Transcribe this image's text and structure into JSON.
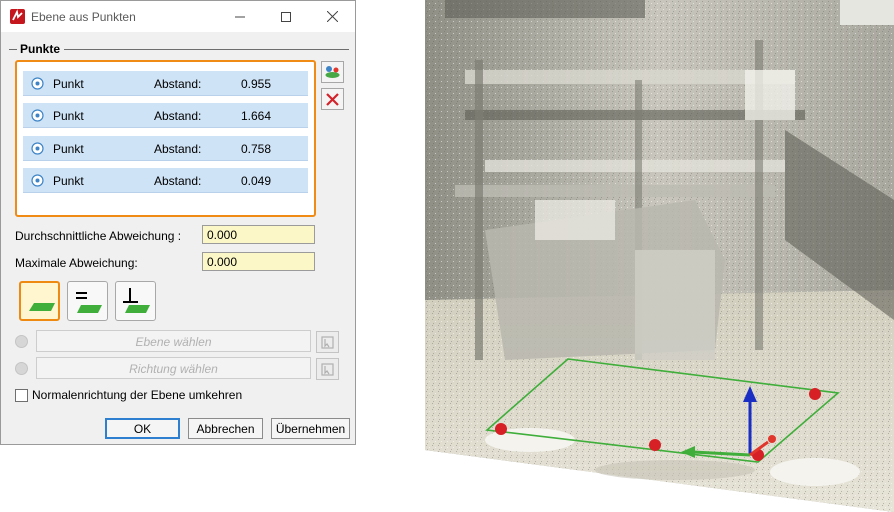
{
  "dialog": {
    "title": "Ebene aus Punkten",
    "group_label": "Punkte",
    "points": [
      {
        "label": "Punkt",
        "distance_label": "Abstand:",
        "distance": "0.955"
      },
      {
        "label": "Punkt",
        "distance_label": "Abstand:",
        "distance": "1.664"
      },
      {
        "label": "Punkt",
        "distance_label": "Abstand:",
        "distance": "0.758"
      },
      {
        "label": "Punkt",
        "distance_label": "Abstand:",
        "distance": "0.049"
      }
    ],
    "avg_deviation": {
      "label": "Durchschnittliche Abweichung :",
      "value": "0.000"
    },
    "max_deviation": {
      "label": "Maximale Abweichung:",
      "value": "0.000"
    },
    "plane_select_placeholder": "Ebene wählen",
    "direction_select_placeholder": "Richtung wählen",
    "invert_normal_label": "Normalenrichtung der Ebene umkehren",
    "invert_normal_checked": false,
    "buttons": {
      "ok": "OK",
      "cancel": "Abbrechen",
      "apply": "Übernehmen"
    },
    "icons": {
      "app": "app-logo-icon",
      "add_point": "add-point-icon",
      "delete_point": "delete-point-icon",
      "mode_plane": "plane-mode-icon",
      "mode_parallel": "parallel-plane-mode-icon",
      "mode_perpendicular": "perpendicular-plane-mode-icon"
    },
    "colors": {
      "accent": "#f08c16",
      "list_row": "#cfe3f6",
      "input_bg": "#fbf7c7",
      "plane_green": "#3fae3a"
    }
  },
  "viewport": {
    "description_icons": [
      "point-cloud-scene",
      "plane-outline",
      "axis-triad"
    ],
    "point_markers_count": 4
  }
}
